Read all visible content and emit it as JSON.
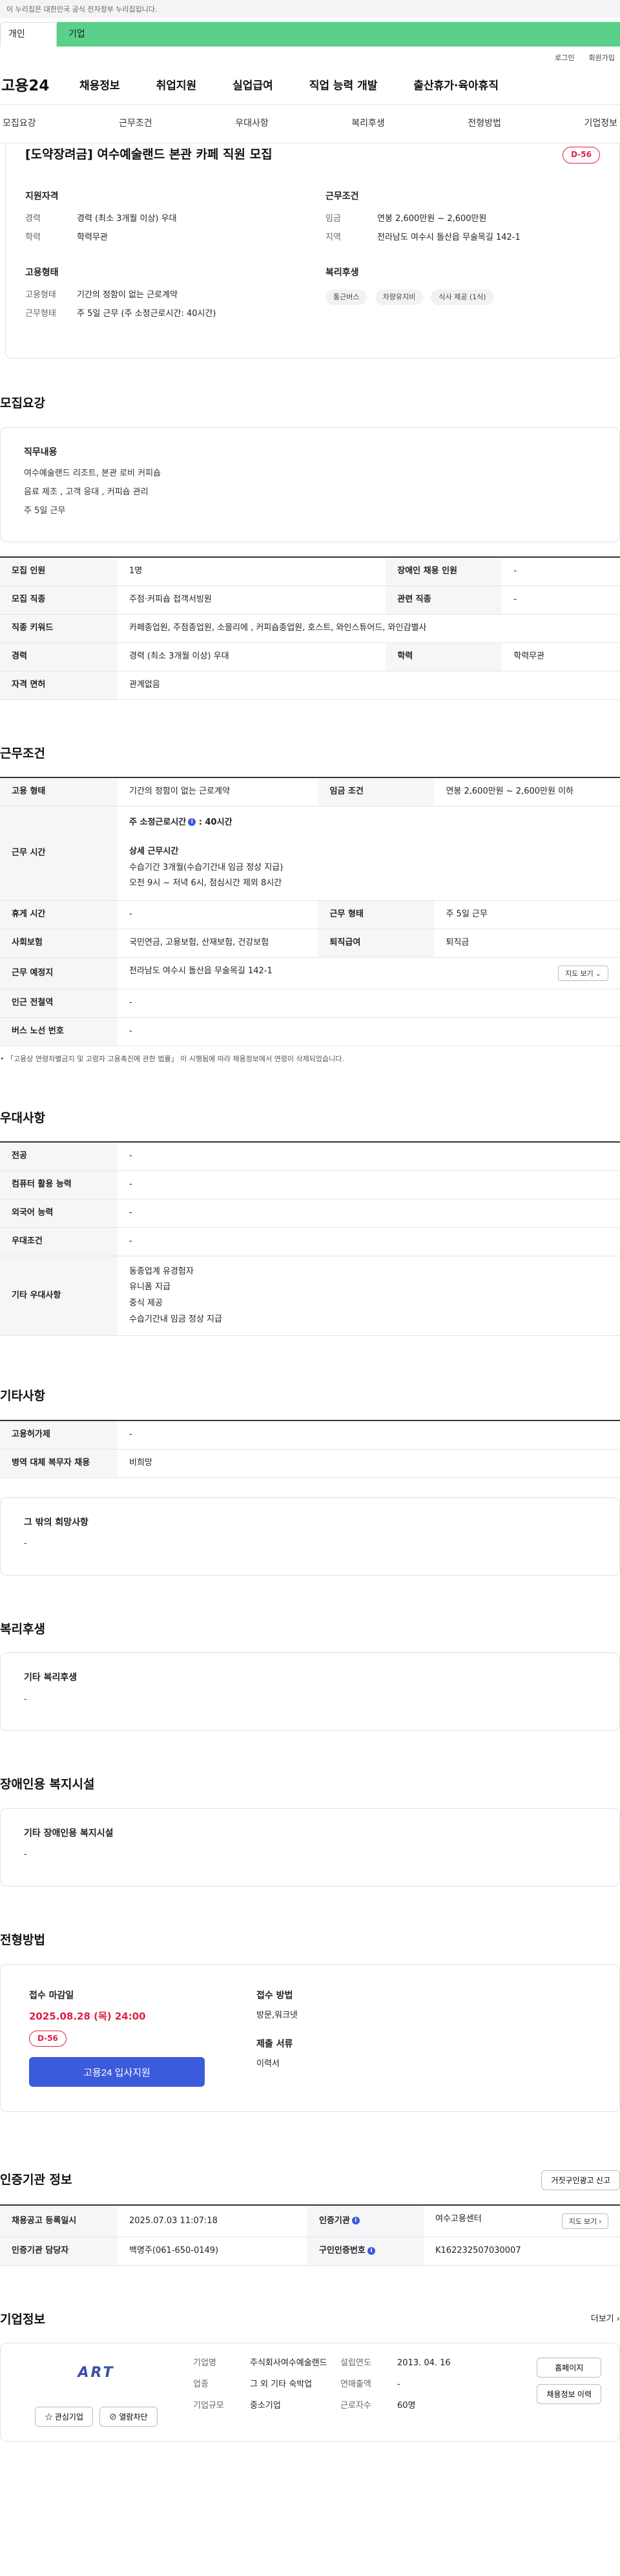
{
  "gov_banner": "이 누리집은 대한민국 공식 전자정부 누리집입니다.",
  "tabs": [
    "개인",
    "기업"
  ],
  "util": [
    "로그인",
    "회원가입"
  ],
  "logo": "고용24",
  "gnb": [
    "채용정보",
    "취업지원",
    "실업급여",
    "직업 능력 개발",
    "출산휴가·육아휴직"
  ],
  "anchors": [
    "모집요강",
    "근무조건",
    "우대사항",
    "복리후생",
    "전형방법",
    "기업정보"
  ],
  "title": "[도약장려금] 여수예술랜드 본관 카페 직원 모집",
  "dday": "D-56",
  "summary": {
    "qual_title": "지원자격",
    "qual": [
      {
        "k": "경력",
        "v": "경력 (최소 3개월 이상) 우대"
      },
      {
        "k": "학력",
        "v": "학력무관"
      }
    ],
    "cond_title": "근무조건",
    "cond": [
      {
        "k": "임금",
        "v": "연봉 2,600만원 ~ 2,600만원"
      },
      {
        "k": "지역",
        "v": "전라남도 여수시 돌산읍 무술목길 142-1"
      }
    ],
    "emp_title": "고용형태",
    "emp": [
      {
        "k": "고용형태",
        "v": "기간의 정함이 없는 근로계약"
      },
      {
        "k": "근무형태",
        "v": "주 5일 근무 (주 소정근로시간: 40시간)"
      }
    ],
    "welfare_title": "복리후생",
    "welfare": [
      "통근버스",
      "차량유지비",
      "식사 제공 (1식)"
    ]
  },
  "recruit": {
    "title": "모집요강",
    "job_title": "직무내용",
    "job_lines": [
      "여수예술랜드 리조트, 본관 로비 커피숍",
      "음료 제조 , 고객 응대 , 커피숍 관리",
      "주 5일 근무"
    ],
    "rows": [
      [
        "모집 인원",
        "1명",
        "장애인 채용 인원",
        "-"
      ],
      [
        "모집 직종",
        "주점·커피숍 접객서빙원",
        "관련 직종",
        "-"
      ],
      [
        "직종 키워드",
        "카페종업원, 주점종업원, 소믈리에 , 커피숍종업원, 호스트, 와인스튜어드, 와인감별사",
        "",
        ""
      ],
      [
        "경력",
        "경력 (최소 3개월 이상) 우대",
        "학력",
        "학력무관"
      ],
      [
        "자격 면허",
        "관계없음",
        "",
        ""
      ]
    ]
  },
  "work": {
    "title": "근무조건",
    "r1": [
      "고용 형태",
      "기간의 정함이 없는 근로계약",
      "임금 조건",
      "연봉 2,600만원 ~ 2,600만원 이하"
    ],
    "time_label": "근무 시간",
    "time_main": "주 소정근로시간",
    "time_hours": "40시간",
    "time_detail_title": "상세 근무시간",
    "time_detail": [
      "수습기간 3개월(수습기간내 임금 정상 지급)",
      "오전 9시 ~ 저녁 6시, 점심시간 제외 8시간"
    ],
    "r3": [
      "휴게 시간",
      "-",
      "근무 형태",
      "주 5일 근무"
    ],
    "r4": [
      "사회보험",
      "국민연금, 고용보험, 산재보험, 건강보험",
      "퇴직급여",
      "퇴직금"
    ],
    "r5": [
      "근무 예정지",
      "전라남도 여수시 돌산읍 무술목길 142-1"
    ],
    "map_btn": "지도 보기",
    "r6": [
      "인근 전철역",
      "-"
    ],
    "r7": [
      "버스 노선 번호",
      "-"
    ],
    "note": "「고용상 연령차별금지 및 고령자 고용촉진에 관한 법률」 이 시행됨에 따라 채용정보에서 연령이 삭제되었습니다."
  },
  "pref": {
    "title": "우대사항",
    "rows": [
      [
        "전공",
        "-"
      ],
      [
        "컴퓨터 활용 능력",
        "-"
      ],
      [
        "외국어 능력",
        "-"
      ],
      [
        "우대조건",
        "-"
      ]
    ],
    "etc_label": "기타 우대사항",
    "etc": [
      "동종업계 유경험자",
      "유니폼 지급",
      "중식 제공",
      "수습기간내 임금 정상 지급"
    ]
  },
  "other": {
    "title": "기타사항",
    "rows": [
      [
        "고용허가제",
        "-"
      ],
      [
        "병역 대체 복무자 채용",
        "비희망"
      ]
    ],
    "wish_title": "그 밖의 희망사항",
    "wish": "-"
  },
  "welfare": {
    "title": "복리후생",
    "sub": "기타 복리후생",
    "val": "-"
  },
  "disab": {
    "title": "장애인용 복지시설",
    "sub": "기타 장애인용 복지시설",
    "val": "-"
  },
  "process": {
    "title": "전형방법",
    "deadline_label": "접수 마감일",
    "deadline": "2025.08.28 (목) 24:00",
    "dday": "D-56",
    "apply_btn": "고용24 입사지원",
    "method_label": "접수 방법",
    "method": "방문,워크넷",
    "docs_label": "제출 서류",
    "docs": "이력서"
  },
  "agency": {
    "title": "인증기관 정보",
    "report_btn": "거짓구인광고 신고",
    "r1": [
      "채용공고 등록일시",
      "2025.07.03 11:07:18",
      "인증기관",
      "여수고용센터"
    ],
    "r2": [
      "인증기관 담당자",
      "백명주(061-650-0149)",
      "구인인증번호",
      "K162232507030007"
    ],
    "map_btn": "지도 보기"
  },
  "company": {
    "title": "기업정보",
    "more": "더보기",
    "logo_text": "ART",
    "fav": "관심기업",
    "block": "열람차단",
    "k1": "기업명",
    "v1": "주식회사여수예술랜드",
    "k2": "설립연도",
    "v2": "2013. 04. 16",
    "k3": "업종",
    "v3": "그 외 기타 숙박업",
    "k4": "연매출액",
    "v4": "-",
    "k5": "기업규모",
    "v5": "중소기업",
    "k6": "근로자수",
    "v6": "60명",
    "home": "홈페이지",
    "history": "채용정보 이력"
  }
}
